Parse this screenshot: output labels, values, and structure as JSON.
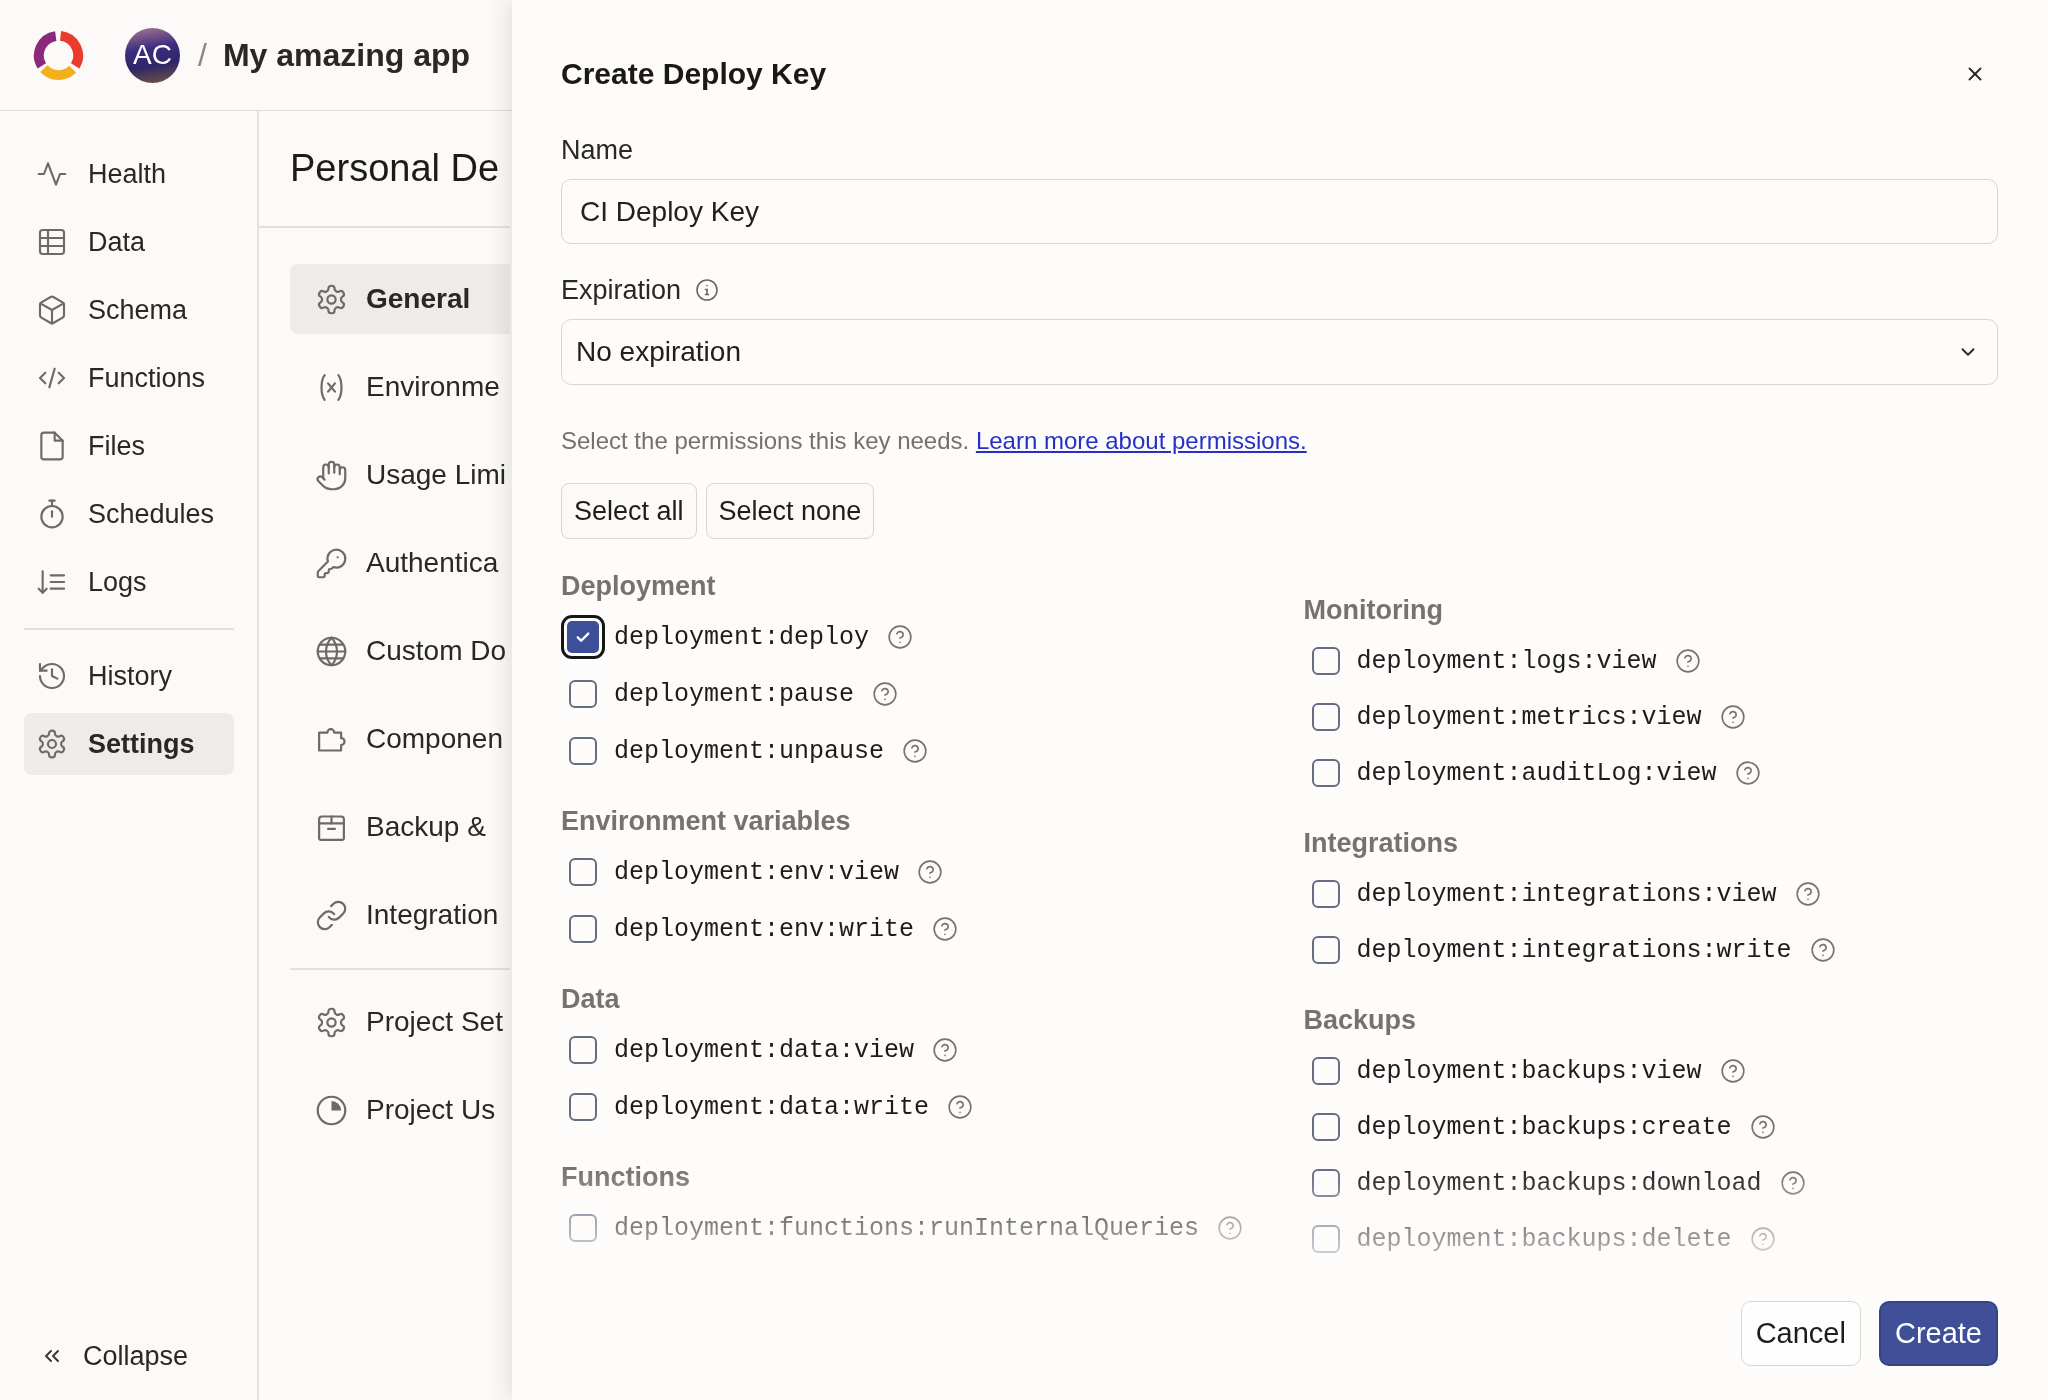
{
  "header": {
    "avatar_initials": "AC",
    "separator": "/",
    "project_name": "My amazing app"
  },
  "sidebar": {
    "groups": [
      {
        "items": [
          {
            "label": "Health",
            "selected": false
          },
          {
            "label": "Data",
            "selected": false
          },
          {
            "label": "Schema",
            "selected": false
          },
          {
            "label": "Functions",
            "selected": false
          },
          {
            "label": "Files",
            "selected": false
          },
          {
            "label": "Schedules",
            "selected": false
          },
          {
            "label": "Logs",
            "selected": false
          }
        ]
      },
      {
        "items": [
          {
            "label": "History",
            "selected": false
          },
          {
            "label": "Settings",
            "selected": true
          }
        ]
      }
    ],
    "collapse_label": "Collapse"
  },
  "settings_panel": {
    "title": "Personal De",
    "groups": [
      {
        "items": [
          {
            "label": "General",
            "selected": true
          },
          {
            "label": "Environme",
            "selected": false
          },
          {
            "label": "Usage Limi",
            "selected": false
          },
          {
            "label": "Authentica",
            "selected": false
          },
          {
            "label": "Custom Do",
            "selected": false
          },
          {
            "label": "Componen",
            "selected": false
          },
          {
            "label": "Backup &",
            "selected": false
          },
          {
            "label": "Integration",
            "selected": false
          }
        ]
      },
      {
        "items": [
          {
            "label": "Project Set",
            "selected": false
          },
          {
            "label": "Project Us",
            "selected": false
          }
        ]
      }
    ]
  },
  "dialog": {
    "title": "Create Deploy Key",
    "name_field": {
      "label": "Name",
      "value": "CI Deploy Key"
    },
    "expiration_field": {
      "label": "Expiration",
      "value": "No expiration"
    },
    "permissions_hint": {
      "text": "Select the permissions this key needs.",
      "link": "Learn more about permissions."
    },
    "bulk_buttons": [
      "Select all",
      "Select none"
    ],
    "permission_columns": [
      {
        "sections": [
          {
            "heading": "Deployment",
            "permissions": [
              {
                "name": "deployment:deploy",
                "checked": true,
                "focused": true
              },
              {
                "name": "deployment:pause",
                "checked": false,
                "focused": false
              },
              {
                "name": "deployment:unpause",
                "checked": false,
                "focused": false
              }
            ]
          },
          {
            "heading": "Environment variables",
            "permissions": [
              {
                "name": "deployment:env:view",
                "checked": false,
                "focused": false
              },
              {
                "name": "deployment:env:write",
                "checked": false,
                "focused": false
              }
            ]
          },
          {
            "heading": "Data",
            "permissions": [
              {
                "name": "deployment:data:view",
                "checked": false,
                "focused": false
              },
              {
                "name": "deployment:data:write",
                "checked": false,
                "focused": false
              }
            ]
          },
          {
            "heading": "Functions",
            "permissions": [
              {
                "name": "deployment:functions:runInternalQueries",
                "checked": false,
                "focused": false
              }
            ]
          }
        ]
      },
      {
        "sections": [
          {
            "heading": "Monitoring",
            "permissions": [
              {
                "name": "deployment:logs:view",
                "checked": false,
                "focused": false
              },
              {
                "name": "deployment:metrics:view",
                "checked": false,
                "focused": false
              },
              {
                "name": "deployment:auditLog:view",
                "checked": false,
                "focused": false
              }
            ]
          },
          {
            "heading": "Integrations",
            "permissions": [
              {
                "name": "deployment:integrations:view",
                "checked": false,
                "focused": false
              },
              {
                "name": "deployment:integrations:write",
                "checked": false,
                "focused": false
              }
            ]
          },
          {
            "heading": "Backups",
            "permissions": [
              {
                "name": "deployment:backups:view",
                "checked": false,
                "focused": false
              },
              {
                "name": "deployment:backups:create",
                "checked": false,
                "focused": false
              },
              {
                "name": "deployment:backups:download",
                "checked": false,
                "focused": false
              },
              {
                "name": "deployment:backups:delete",
                "checked": false,
                "focused": false
              }
            ]
          }
        ]
      }
    ],
    "footer_buttons": [
      {
        "label": "Cancel",
        "kind": "secondary"
      },
      {
        "label": "Create",
        "kind": "primary"
      }
    ]
  }
}
